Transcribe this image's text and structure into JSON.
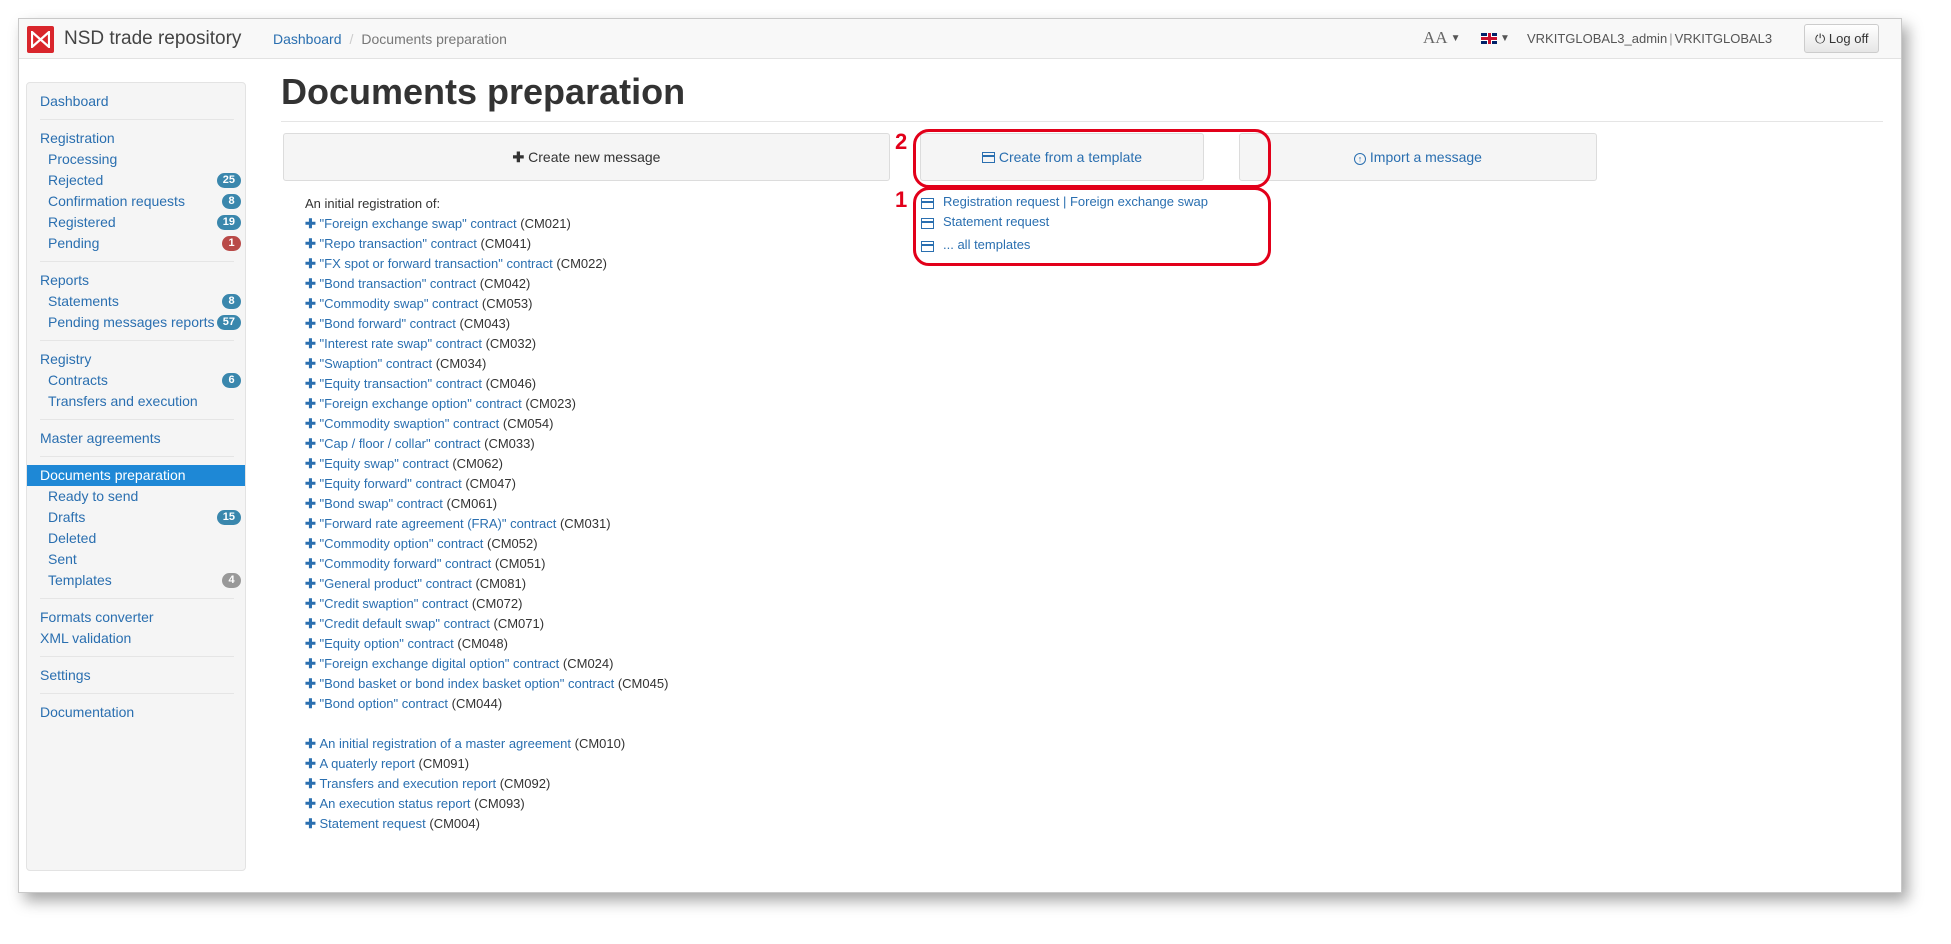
{
  "app": {
    "brand": "NSD trade repository"
  },
  "breadcrumb": {
    "home": "Dashboard",
    "current": "Documents preparation"
  },
  "header": {
    "font_size_label": "AA",
    "user": "VRKITGLOBAL3_admin",
    "org": "VRKITGLOBAL3",
    "logoff_label": "Log off"
  },
  "sidebar": {
    "dashboard": "Dashboard",
    "registration": "Registration",
    "processing": "Processing",
    "rejected": {
      "label": "Rejected",
      "count": "25"
    },
    "confirmation": {
      "label": "Confirmation requests",
      "count": "8"
    },
    "registered": {
      "label": "Registered",
      "count": "19"
    },
    "pending": {
      "label": "Pending",
      "count": "1"
    },
    "reports": "Reports",
    "statements": {
      "label": "Statements",
      "count": "8"
    },
    "pending_reports": {
      "label": "Pending messages reports",
      "count": "57"
    },
    "registry": "Registry",
    "contracts": {
      "label": "Contracts",
      "count": "6"
    },
    "transfers": "Transfers and execution",
    "master_agreements": "Master agreements",
    "documents_preparation": "Documents preparation",
    "ready_to_send": "Ready to send",
    "drafts": {
      "label": "Drafts",
      "count": "15"
    },
    "deleted": "Deleted",
    "sent": "Sent",
    "templates": {
      "label": "Templates",
      "count": "4"
    },
    "formats_converter": "Formats converter",
    "xml_validation": "XML validation",
    "settings": "Settings",
    "documentation": "Documentation"
  },
  "main": {
    "title": "Documents preparation",
    "create_new": "Create new message",
    "create_template": "Create from a template",
    "import": "Import a message",
    "initial_registration_intro": "An initial registration of:",
    "registrations": [
      {
        "label": "\"Foreign exchange swap\" contract",
        "code": "(CM021)"
      },
      {
        "label": "\"Repo transaction\" contract",
        "code": "(CM041)"
      },
      {
        "label": "\"FX spot or forward transaction\" contract",
        "code": "(CM022)"
      },
      {
        "label": "\"Bond transaction\" contract",
        "code": "(CM042)"
      },
      {
        "label": "\"Commodity swap\" contract",
        "code": "(CM053)"
      },
      {
        "label": "\"Bond forward\" contract",
        "code": "(CM043)"
      },
      {
        "label": "\"Interest rate swap\" contract",
        "code": "(CM032)"
      },
      {
        "label": "\"Swaption\" contract",
        "code": "(CM034)"
      },
      {
        "label": "\"Equity transaction\" contract",
        "code": "(CM046)"
      },
      {
        "label": "\"Foreign exchange option\" contract",
        "code": "(CM023)"
      },
      {
        "label": "\"Commodity swaption\" contract",
        "code": "(CM054)"
      },
      {
        "label": "\"Cap / floor / collar\" contract",
        "code": "(CM033)"
      },
      {
        "label": "\"Equity swap\" contract",
        "code": "(CM062)"
      },
      {
        "label": "\"Equity forward\" contract",
        "code": "(CM047)"
      },
      {
        "label": "\"Bond swap\" contract",
        "code": "(CM061)"
      },
      {
        "label": "\"Forward rate agreement (FRA)\" contract",
        "code": "(CM031)"
      },
      {
        "label": "\"Commodity option\" contract",
        "code": "(CM052)"
      },
      {
        "label": "\"Commodity forward\" contract",
        "code": "(CM051)"
      },
      {
        "label": "\"General product\" contract",
        "code": "(CM081)"
      },
      {
        "label": "\"Credit swaption\" contract",
        "code": "(CM072)"
      },
      {
        "label": "\"Credit default swap\" contract",
        "code": "(CM071)"
      },
      {
        "label": "\"Equity option\" contract",
        "code": "(CM048)"
      },
      {
        "label": "\"Foreign exchange digital option\" contract",
        "code": "(CM024)"
      },
      {
        "label": "\"Bond basket or bond index basket option\" contract",
        "code": "(CM045)"
      },
      {
        "label": "\"Bond option\" contract",
        "code": "(CM044)"
      }
    ],
    "other_messages": [
      {
        "label": "An initial registration of a master agreement",
        "code": "(CM010)"
      },
      {
        "label": "A quaterly report",
        "code": "(CM091)"
      },
      {
        "label": "Transfers and execution report",
        "code": "(CM092)"
      },
      {
        "label": "An execution status report",
        "code": "(CM093)"
      },
      {
        "label": "Statement request",
        "code": "(CM004)"
      }
    ],
    "templates": [
      "Registration request | Foreign exchange swap",
      "Statement request",
      "... all templates"
    ]
  },
  "annotations": {
    "one": "1",
    "two": "2",
    "color": "#e2001a"
  }
}
